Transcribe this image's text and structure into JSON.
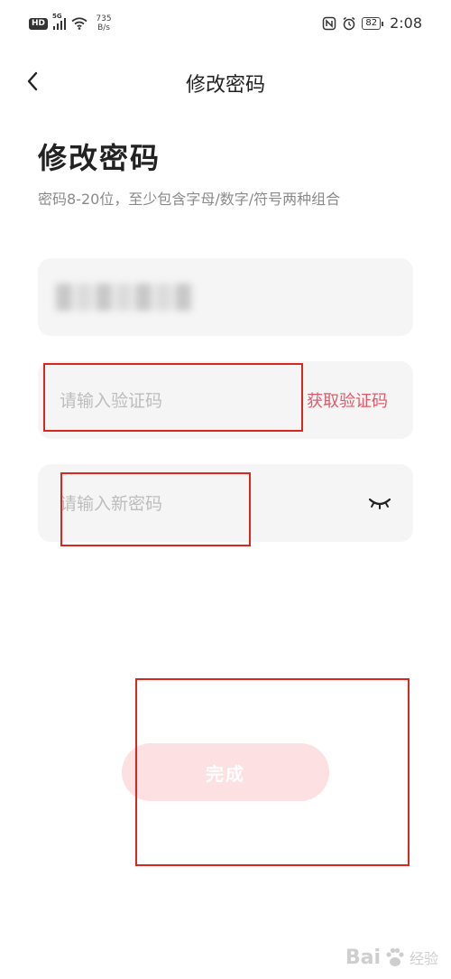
{
  "status_bar": {
    "hd_label": "HD",
    "signal_label": "5G",
    "net_speed_value": "735",
    "net_speed_unit": "B/s",
    "battery": "82",
    "time": "2:08"
  },
  "nav": {
    "title": "修改密码"
  },
  "heading": "修改密码",
  "hint": "密码8-20位，至少包含字母/数字/符号两种组合",
  "fields": {
    "code_placeholder": "请输入验证码",
    "get_code_label": "获取验证码",
    "password_placeholder": "请输入新密码"
  },
  "submit_label": "完成",
  "watermark": {
    "brand": "Bai",
    "suffix": "经验"
  },
  "colors": {
    "accent": "#e05a6a",
    "button_disabled": "#fde0e2",
    "annotation": "#d8271f",
    "field_bg": "#f5f5f5"
  }
}
